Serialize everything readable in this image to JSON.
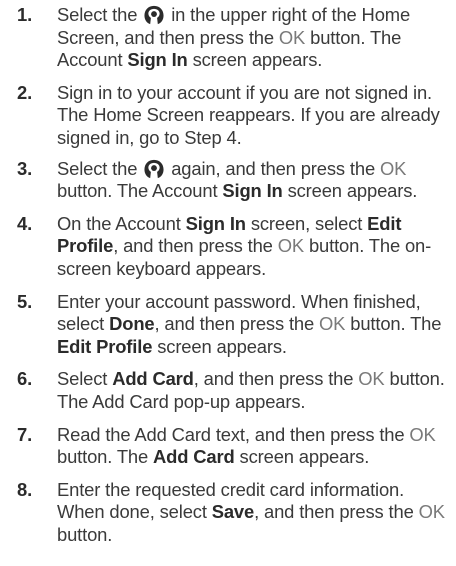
{
  "steps": [
    {
      "num": "1.",
      "p1": "Select the ",
      "p2": " in the upper right of the Home Screen, and then press the ",
      "ok": "OK",
      "p3": " button. The Account ",
      "b1": "Sign In",
      "p4": " screen appears."
    },
    {
      "num": "2.",
      "text": "Sign in to your account if you are not signed in. The Home Screen reappears. If you are already signed in, go to Step 4."
    },
    {
      "num": "3.",
      "p1": "Select the ",
      "p2": " again, and then press the ",
      "ok": "OK",
      "p3": " button. The Account ",
      "b1": "Sign In",
      "p4": " screen appears."
    },
    {
      "num": "4.",
      "p1": "On the Account ",
      "b1": "Sign In",
      "p2": " screen, select ",
      "b2": "Edit Profile",
      "p3": ", and then press the ",
      "ok": "OK",
      "p4": " button. The on-screen keyboard appears."
    },
    {
      "num": "5.",
      "p1": "Enter your account password. When finished, select ",
      "b1": "Done",
      "p2": ", and then press the ",
      "ok": "OK",
      "p3": " button. The ",
      "b2": "Edit Profile",
      "p4": " screen appears."
    },
    {
      "num": "6.",
      "p1": "Select ",
      "b1": "Add Card",
      "p2": ", and then press the ",
      "ok": "OK",
      "p3": " button. The Add Card pop-up appears."
    },
    {
      "num": "7.",
      "p1": "Read the Add Card text, and then press the ",
      "ok": "OK",
      "p2": " button. The ",
      "b1": "Add Card",
      "p3": " screen appears."
    },
    {
      "num": "8.",
      "p1": "Enter the requested credit card information. When done, select ",
      "b1": "Save",
      "p2": ", and then press the ",
      "ok": "OK",
      "p3": " button."
    }
  ],
  "icons": {
    "account": "account-icon"
  },
  "colors": {
    "text": "#3a3a3a",
    "ok_button_text": "#7a7a7a",
    "icon": "#2b2b2b"
  }
}
